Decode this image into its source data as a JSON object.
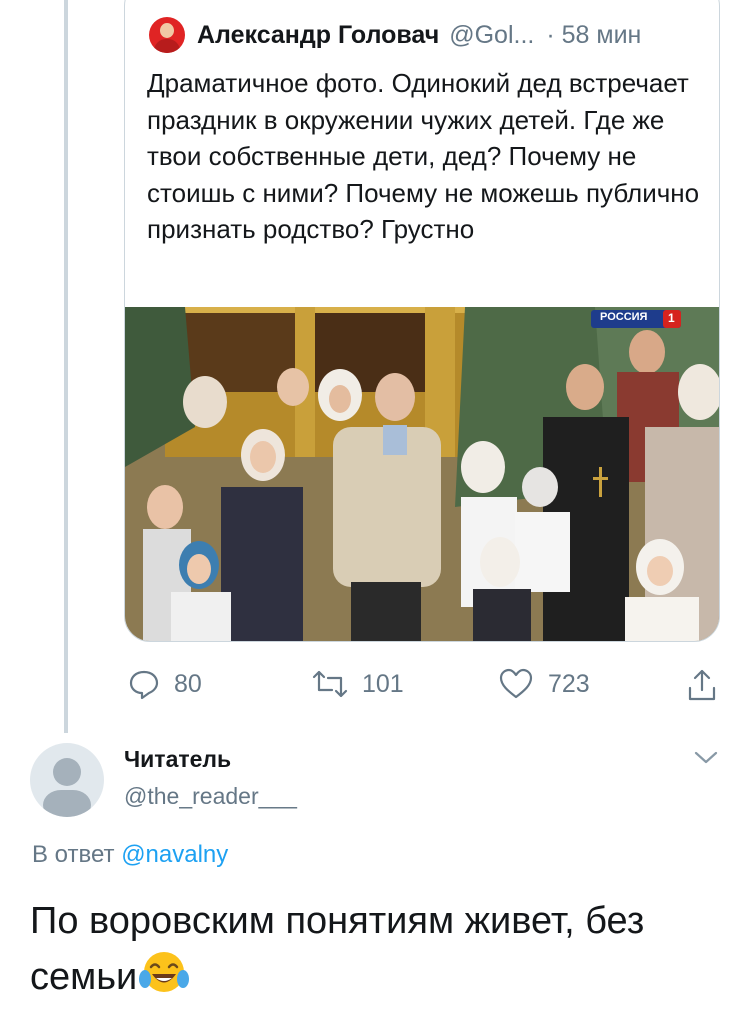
{
  "quoted_tweet": {
    "author_name": "Александр Головач",
    "author_handle": "@Gol...",
    "time_sep": "·",
    "time": "58 мин",
    "text": "Драматичное фото. Одинокий дед встречает праздник в окружении чужих детей. Где же твои собственные дети, дед? Почему не стоишь с ними? Почему не можешь публично признать родство? Грустно",
    "photo": {
      "channel_logo": "РОССИЯ",
      "channel_number": "1"
    }
  },
  "actions": {
    "replies": "80",
    "retweets": "101",
    "likes": "723"
  },
  "reply": {
    "author_name": "Читатель",
    "author_handle": "@the_reader___",
    "reply_to_prefix": "В ответ",
    "reply_to_mention": "@navalny",
    "text": "По воровским понятиям живет, без семьи",
    "emoji": "face-with-tears-of-joy"
  },
  "colors": {
    "secondary_text": "#657786",
    "link": "#1da1f2",
    "border": "#ccd6dd"
  }
}
